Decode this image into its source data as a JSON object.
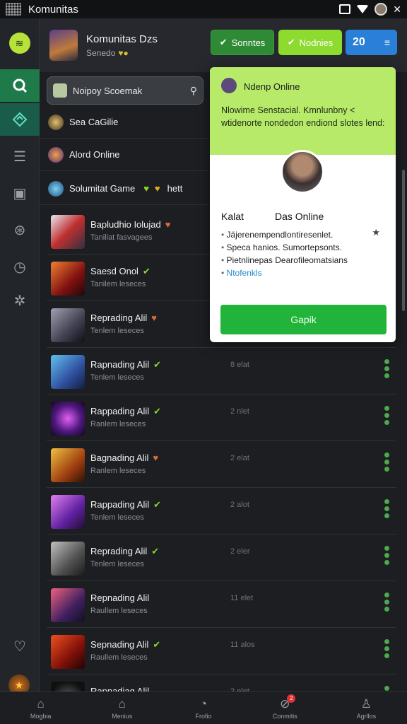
{
  "app": {
    "title": "Komunitas"
  },
  "header": {
    "title": "Komunitas Dzs",
    "subtitle": "Senedo",
    "btn1": "Sonntes",
    "btn2": "Nodnies",
    "btn3": "20"
  },
  "search": {
    "value": "Noipoy Scoemak"
  },
  "shortcuts": [
    {
      "label": "Sea CaGilie"
    },
    {
      "label": "Alord Online"
    },
    {
      "label": "Solumitat Game",
      "after": "hett"
    }
  ],
  "rows": [
    {
      "name": "Bapludhio Iolujad",
      "sub": "Taniliat fasvagees",
      "count": "",
      "heart": "red"
    },
    {
      "name": "Saesd Onol",
      "sub": "Tanilem leseces",
      "count": "",
      "heart": "green"
    },
    {
      "name": "Reprading Alil",
      "sub": "Tenlem leseces",
      "count": "",
      "heart": "red"
    },
    {
      "name": "Rapnading Alil",
      "sub": "Tenlem leseces",
      "count": "8 elat",
      "heart": "green"
    },
    {
      "name": "Rappading Alil",
      "sub": "Ranlem leseces",
      "count": "2 nlet",
      "heart": "green"
    },
    {
      "name": "Bagnading Alil",
      "sub": "Ranlem leseces",
      "count": "2 elat",
      "heart": "red"
    },
    {
      "name": "Rappading Alil",
      "sub": "Tenlem leseces",
      "count": "2 alot",
      "heart": "green"
    },
    {
      "name": "Reprading Alil",
      "sub": "Tenlem leseces",
      "count": "2 eler",
      "heart": "green"
    },
    {
      "name": "Repnading Alil",
      "sub": "Raullem leseces",
      "count": "11 elet",
      "heart": ""
    },
    {
      "name": "Sepnading Alil",
      "sub": "Raullem leseces",
      "count": "11 alos",
      "heart": "green"
    },
    {
      "name": "Rapnadiag Alil",
      "sub": "",
      "count": "2 elet",
      "heart": ""
    }
  ],
  "popup": {
    "title": "Ndenp Online",
    "message": "Nlowime Senstacial. Kmnlunbny < wtidenorte nondedon endiond slotes lend:",
    "name": "Kalat",
    "status": "Das Online",
    "items": [
      "Jäjerenempendlontiresenlet.",
      "Speca hanios. Sumortepsonts.",
      "Pietnlinepas Dearofileomatsians",
      "Ntofenkls"
    ],
    "button": "Gapik"
  },
  "bottom_nav": [
    {
      "label": "Mogbia"
    },
    {
      "label": "Menius"
    },
    {
      "label": "Frofio"
    },
    {
      "label": "Conmitis",
      "badge": "2"
    },
    {
      "label": "Agrllos"
    }
  ],
  "colors": {
    "accent_green": "#22b43a",
    "lime": "#b8ea6a",
    "blue": "#2a7fd8"
  }
}
